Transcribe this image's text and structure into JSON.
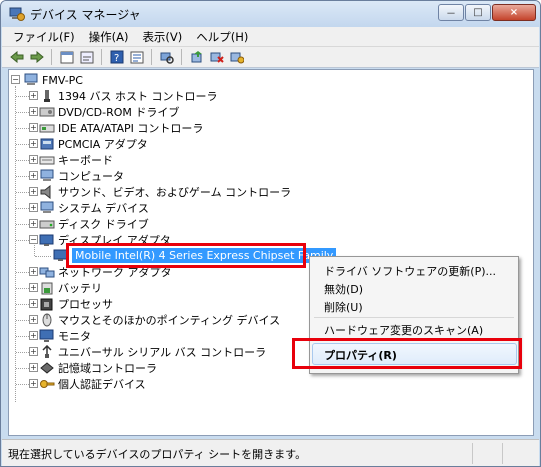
{
  "window": {
    "title": "デバイス マネージャ",
    "minimize": "－",
    "maximize": "□",
    "close": "×"
  },
  "menu": [
    "ファイル(F)",
    "操作(A)",
    "表示(V)",
    "ヘルプ(H)"
  ],
  "toolbar_icons": [
    "back-icon",
    "forward-icon",
    "properties-view-icon",
    "show-hide-icon",
    "help-icon",
    "action-icon",
    "scan-hardware-icon",
    "update-driver-icon",
    "disable-device-icon",
    "uninstall-device-icon"
  ],
  "tree": {
    "root": "FMV-PC",
    "items": [
      "1394 バス ホスト コントローラ",
      "DVD/CD-ROM ドライブ",
      "IDE ATA/ATAPI コントローラ",
      "PCMCIA アダプタ",
      "キーボード",
      "コンピュータ",
      "サウンド、ビデオ、およびゲーム コントローラ",
      "システム デバイス",
      "ディスク ドライブ",
      "ディスプレイ アダプタ",
      "ネットワーク アダプタ",
      "バッテリ",
      "プロセッサ",
      "マウスとそのほかのポインティング デバイス",
      "モニタ",
      "ユニバーサル シリアル バス コントローラ",
      "記憶域コントローラ",
      "個人認証デバイス"
    ],
    "selected_child": "Mobile Intel(R) 4 Series Express Chipset Family"
  },
  "context_menu": {
    "update_driver": "ドライバ ソフトウェアの更新(P)...",
    "disable": "無効(D)",
    "uninstall": "削除(U)",
    "scan": "ハードウェア変更のスキャン(A)",
    "properties": "プロパティ(R)"
  },
  "status": "現在選択しているデバイスのプロパティ シートを開きます。",
  "colors": {
    "selection": "#3399ff",
    "highlight_box": "#e8000b"
  }
}
